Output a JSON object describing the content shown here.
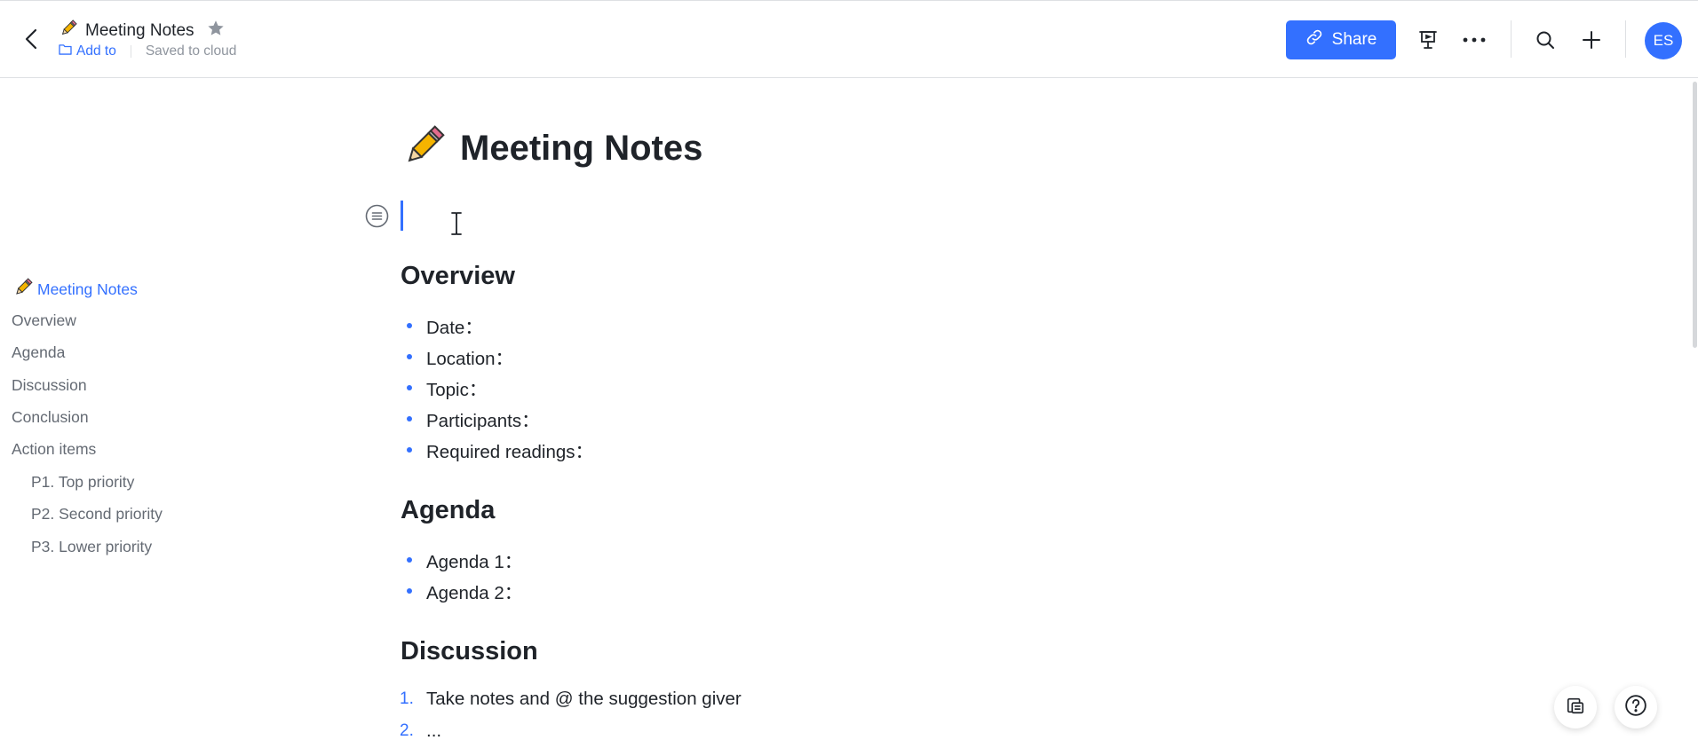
{
  "header": {
    "title": "Meeting Notes",
    "add_to": "Add to",
    "save_status": "Saved to cloud",
    "share_label": "Share",
    "avatar_initials": "ES",
    "accent_color": "#3370ff"
  },
  "outline": {
    "items": [
      {
        "label": "Meeting Notes",
        "active": true
      },
      {
        "label": "Overview"
      },
      {
        "label": "Agenda"
      },
      {
        "label": "Discussion"
      },
      {
        "label": "Conclusion"
      },
      {
        "label": "Action items"
      },
      {
        "label": "P1. Top priority"
      },
      {
        "label": "P2. Second priority"
      },
      {
        "label": "P3. Lower priority"
      }
    ]
  },
  "doc": {
    "title": "Meeting Notes",
    "overview": {
      "heading": "Overview",
      "items": [
        "Date：",
        "Location：",
        "Topic：",
        "Participants：",
        "Required readings："
      ]
    },
    "agenda": {
      "heading": "Agenda",
      "items": [
        "Agenda 1：",
        "Agenda 2："
      ]
    },
    "discussion": {
      "heading": "Discussion",
      "items": [
        {
          "num": "1.",
          "text": "Take notes and @ the suggestion giver"
        },
        {
          "num": "2.",
          "text": "..."
        }
      ]
    }
  },
  "icons": [
    "back-icon",
    "pencil-icon",
    "star-icon",
    "folder-icon",
    "link-icon",
    "presentation-icon",
    "more-icon",
    "search-icon",
    "plus-icon",
    "block-menu-icon",
    "text-cursor-icon",
    "outline-toggle-icon",
    "help-icon"
  ]
}
